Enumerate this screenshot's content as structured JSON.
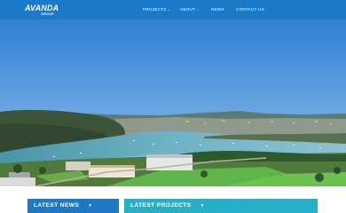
{
  "brand": {
    "name": "AVANDA",
    "sub": "GROUP"
  },
  "nav": {
    "items": [
      {
        "label": "PROJECTS",
        "has_dropdown": true
      },
      {
        "label": "ABOUT",
        "has_dropdown": true
      },
      {
        "label": "NEWS",
        "has_dropdown": false
      },
      {
        "label": "CONTACT US",
        "has_dropdown": false
      }
    ],
    "dropdown_icon": "chevron-down-icon"
  },
  "tiles": {
    "latest_news": {
      "label": "LATEST NEWS",
      "icon": "caret-down-icon"
    },
    "latest_projects": {
      "label": "LATEST PROJECTS",
      "icon": "caret-down-icon"
    }
  },
  "colors": {
    "navbar": "#1a79c8",
    "news_tile": "#1d78c6",
    "projects_tile": "#25b0c8"
  }
}
